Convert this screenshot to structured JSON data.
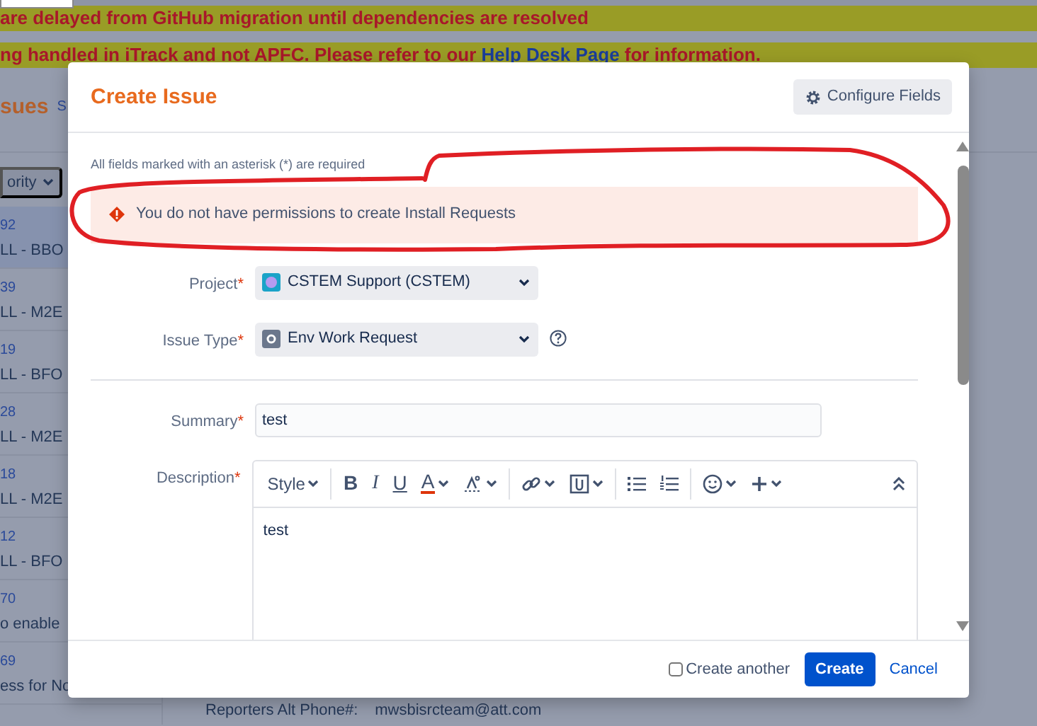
{
  "background": {
    "banners": [
      {
        "text": "are delayed from GitHub migration until dependencies are resolved"
      },
      {
        "text": "ng handled in iTrack and not APFC. Please refer to our ",
        "link": "Help Desk Page",
        "text_after": " for information."
      }
    ],
    "heading": "sues",
    "heading_link": "S",
    "filter": "ority",
    "issues": [
      {
        "key": "92",
        "summary": "LL - BBO",
        "selected": true
      },
      {
        "key": "39",
        "summary": "LL - M2E",
        "selected": false
      },
      {
        "key": "19",
        "summary": "LL - BFO",
        "selected": false
      },
      {
        "key": "28",
        "summary": "LL - M2E",
        "selected": false
      },
      {
        "key": "18",
        "summary": "LL - M2E",
        "selected": false
      },
      {
        "key": "12",
        "summary": "LL - BFO",
        "selected": false
      },
      {
        "key": "70",
        "summary": "o enable",
        "selected": false
      },
      {
        "key": "69",
        "summary": "ess for No",
        "selected": false
      }
    ],
    "detail": {
      "label": "Reporters Alt Phone#:",
      "value": "mwsbisrcteam@att.com"
    }
  },
  "dialog": {
    "title": "Create Issue",
    "configure_button": "Configure Fields",
    "required_note": "All fields marked with an asterisk (*) are required",
    "error": "You do not have permissions to create Install Requests",
    "fields": [
      {
        "kind": "select",
        "label": "Project",
        "required_mark": "*",
        "value": "CSTEM Support (CSTEM)",
        "help": false
      },
      {
        "kind": "select",
        "label": "Issue Type",
        "required_mark": "*",
        "value": "Env Work Request",
        "help": true
      },
      {
        "kind": "divider"
      },
      {
        "kind": "input",
        "label": "Summary",
        "required_mark": "*",
        "value": "test"
      },
      {
        "kind": "editor",
        "label": "Description",
        "required_mark": "*",
        "value": "test"
      }
    ],
    "toolbar": [
      [
        {
          "kind": "style",
          "label": "Style",
          "menu": true
        }
      ],
      [
        {
          "kind": "bold",
          "label": "B",
          "menu": false
        },
        {
          "kind": "italic",
          "label": "I",
          "menu": false
        },
        {
          "kind": "underline",
          "label": "U",
          "menu": false
        },
        {
          "kind": "color",
          "label": "A",
          "menu": true
        },
        {
          "kind": "format",
          "menu": true
        }
      ],
      [
        {
          "kind": "link",
          "menu": true
        },
        {
          "kind": "attach",
          "menu": true
        }
      ],
      [
        {
          "kind": "bullets",
          "menu": false
        },
        {
          "kind": "numbers",
          "menu": false
        }
      ],
      [
        {
          "kind": "emoji",
          "menu": true
        },
        {
          "kind": "insert",
          "menu": true
        }
      ]
    ],
    "create_another": {
      "label": "Create another",
      "checked": false
    },
    "create_button": "Create",
    "cancel": "Cancel"
  }
}
